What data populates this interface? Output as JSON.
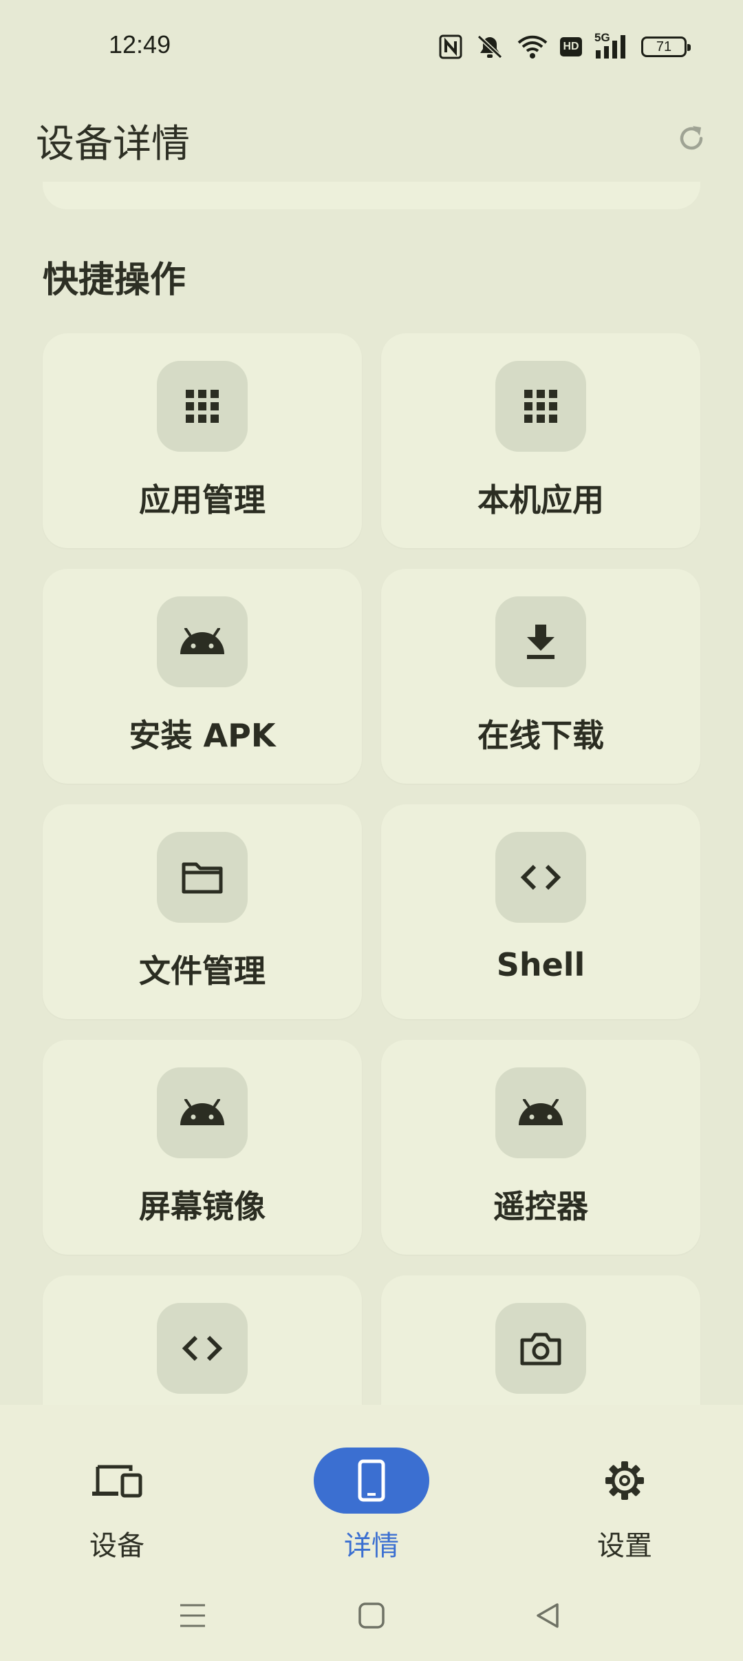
{
  "status_bar": {
    "time": "12:49",
    "battery": "71",
    "network": "5G",
    "hd_label": "HD"
  },
  "app_bar": {
    "title": "设备详情"
  },
  "quick_actions": {
    "title": "快捷操作",
    "items": [
      {
        "label": "应用管理",
        "icon": "grid-icon"
      },
      {
        "label": "本机应用",
        "icon": "grid-icon"
      },
      {
        "label": "安装 APK",
        "icon": "android-icon"
      },
      {
        "label": "在线下载",
        "icon": "download-icon"
      },
      {
        "label": "文件管理",
        "icon": "folder-icon"
      },
      {
        "label": "Shell",
        "icon": "code-icon"
      },
      {
        "label": "屏幕镜像",
        "icon": "android-icon"
      },
      {
        "label": "遥控器",
        "icon": "android-icon"
      },
      {
        "label": "",
        "icon": "code-icon"
      },
      {
        "label": "",
        "icon": "camera-icon"
      }
    ]
  },
  "bottom_nav": {
    "items": [
      {
        "label": "设备",
        "icon": "devices-icon",
        "active": false
      },
      {
        "label": "详情",
        "icon": "phone-icon",
        "active": true
      },
      {
        "label": "设置",
        "icon": "gear-icon",
        "active": false
      }
    ]
  },
  "colors": {
    "background": "#e6e9d4",
    "tile": "#edf0db",
    "icon_bg": "#d6dbc6",
    "accent": "#3b6fd1"
  }
}
